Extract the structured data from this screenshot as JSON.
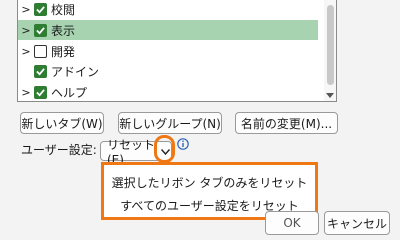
{
  "tree": {
    "items": [
      {
        "label": "校閲",
        "checked": true,
        "expandable": true
      },
      {
        "label": "表示",
        "checked": true,
        "expandable": true,
        "selected": true
      },
      {
        "label": "開発",
        "checked": false,
        "expandable": true
      },
      {
        "label": "アドイン",
        "checked": true,
        "expandable": false
      },
      {
        "label": "ヘルプ",
        "checked": true,
        "expandable": true
      }
    ]
  },
  "buttons": {
    "new_tab": "新しいタブ(W)",
    "new_group": "新しいグループ(N)",
    "rename": "名前の変更(M)..."
  },
  "customization": {
    "label": "ユーザー設定:",
    "reset_button": "リセット(E)",
    "menu": [
      "選択したリボン タブのみをリセット",
      "すべてのユーザー設定をリセット"
    ]
  },
  "footer": {
    "ok": "OK",
    "cancel": "キャンセル"
  },
  "colors": {
    "highlight": "#f07814",
    "selection": "#a7d3b0",
    "checkbox": "#2e7d32"
  }
}
